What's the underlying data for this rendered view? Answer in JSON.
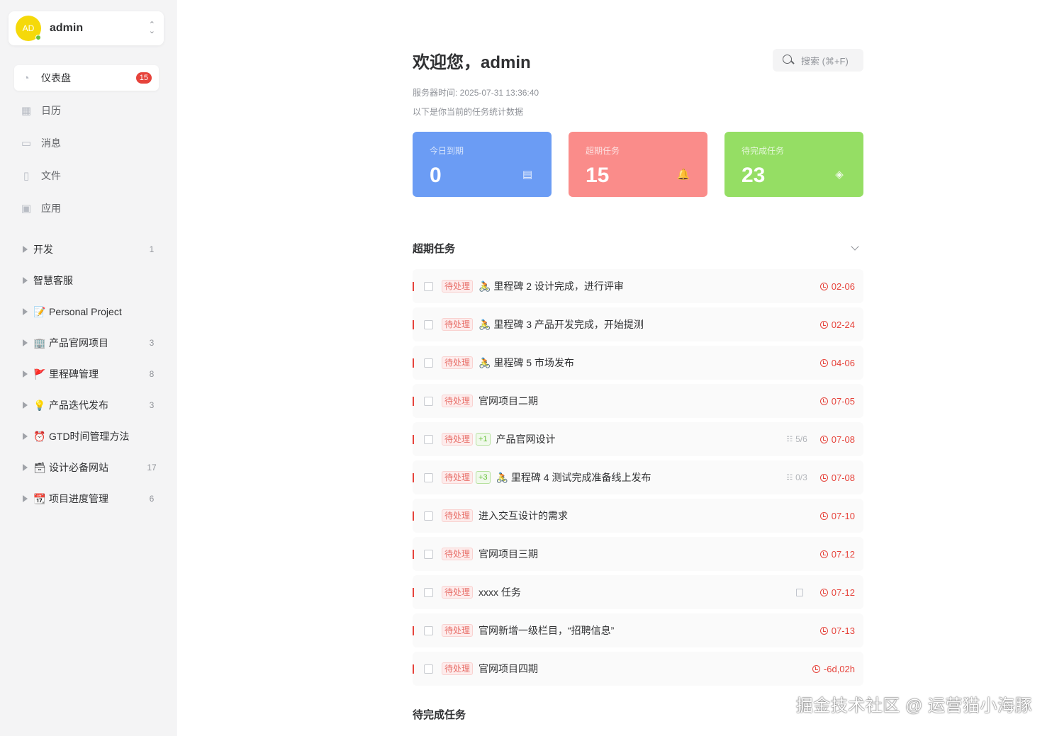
{
  "user": {
    "avatar_text": "AD",
    "name": "admin"
  },
  "nav": [
    {
      "label": "仪表盘",
      "icon": "dashboard-icon",
      "glyph": "◔",
      "badge": "15",
      "active": true
    },
    {
      "label": "日历",
      "icon": "calendar-icon",
      "glyph": "▦"
    },
    {
      "label": "消息",
      "icon": "message-icon",
      "glyph": "▭"
    },
    {
      "label": "文件",
      "icon": "file-icon",
      "glyph": "▯"
    },
    {
      "label": "应用",
      "icon": "apps-icon",
      "glyph": "▣"
    }
  ],
  "projects": [
    {
      "label": "开发",
      "emoji": "",
      "count": "1"
    },
    {
      "label": "智慧客服",
      "emoji": "",
      "count": ""
    },
    {
      "label": "Personal Project",
      "emoji": "📝",
      "count": ""
    },
    {
      "label": "产品官网项目",
      "emoji": "🏢",
      "count": "3"
    },
    {
      "label": "里程碑管理",
      "emoji": "🚩",
      "count": "8"
    },
    {
      "label": "产品迭代发布",
      "emoji": "💡",
      "count": "3"
    },
    {
      "label": "GTD时间管理方法",
      "emoji": "⏰",
      "count": ""
    },
    {
      "label": "设计必备网站",
      "emoji": "🗃",
      "count": "17"
    },
    {
      "label": "项目进度管理",
      "emoji": "📆",
      "count": "6"
    }
  ],
  "header": {
    "welcome": "欢迎您，admin",
    "search_placeholder": "搜索 (⌘+F)",
    "server_time": "服务器时间: 2025-07-31 13:36:40",
    "subtitle": "以下是你当前的任务统计数据"
  },
  "cards": [
    {
      "label": "今日到期",
      "value": "0",
      "color": "#6b9cf4",
      "icon": "calendar-list-icon",
      "glyph": "▤"
    },
    {
      "label": "超期任务",
      "value": "15",
      "color": "#fa8c8a",
      "icon": "bell-icon",
      "glyph": "🔔"
    },
    {
      "label": "待完成任务",
      "value": "23",
      "color": "#95de64",
      "icon": "layers-icon",
      "glyph": "◈"
    }
  ],
  "overdue_section": {
    "title": "超期任务"
  },
  "tasks": [
    {
      "tag": "待处理",
      "sub": "",
      "emoji": "🚴",
      "title": "里程碑 2 设计完成，进行评审",
      "subtasks": "",
      "note": false,
      "due": "02-06"
    },
    {
      "tag": "待处理",
      "sub": "",
      "emoji": "🚴",
      "title": "里程碑 3 产品开发完成，开始提测",
      "subtasks": "",
      "note": false,
      "due": "02-24"
    },
    {
      "tag": "待处理",
      "sub": "",
      "emoji": "🚴",
      "title": "里程碑 5 市场发布",
      "subtasks": "",
      "note": false,
      "due": "04-06"
    },
    {
      "tag": "待处理",
      "sub": "",
      "emoji": "",
      "title": "官网项目二期",
      "subtasks": "",
      "note": false,
      "due": "07-05"
    },
    {
      "tag": "待处理",
      "sub": "+1",
      "emoji": "",
      "title": "产品官网设计",
      "subtasks": "5/6",
      "note": false,
      "due": "07-08"
    },
    {
      "tag": "待处理",
      "sub": "+3",
      "emoji": "🚴",
      "title": "里程碑 4 测试完成准备线上发布",
      "subtasks": "0/3",
      "note": false,
      "due": "07-08"
    },
    {
      "tag": "待处理",
      "sub": "",
      "emoji": "",
      "title": "进入交互设计的需求",
      "subtasks": "",
      "note": false,
      "due": "07-10"
    },
    {
      "tag": "待处理",
      "sub": "",
      "emoji": "",
      "title": "官网项目三期",
      "subtasks": "",
      "note": false,
      "due": "07-12"
    },
    {
      "tag": "待处理",
      "sub": "",
      "emoji": "",
      "title": "xxxx 任务",
      "subtasks": "",
      "note": true,
      "due": "07-12"
    },
    {
      "tag": "待处理",
      "sub": "",
      "emoji": "",
      "title": "官网新增一级栏目，“招聘信息”",
      "subtasks": "",
      "note": false,
      "due": "07-13"
    },
    {
      "tag": "待处理",
      "sub": "",
      "emoji": "",
      "title": "官网项目四期",
      "subtasks": "",
      "note": false,
      "due": "-6d,02h"
    }
  ],
  "pending_section": {
    "title": "待完成任务"
  },
  "watermark": "掘金技术社区 @ 运营猫小海豚"
}
